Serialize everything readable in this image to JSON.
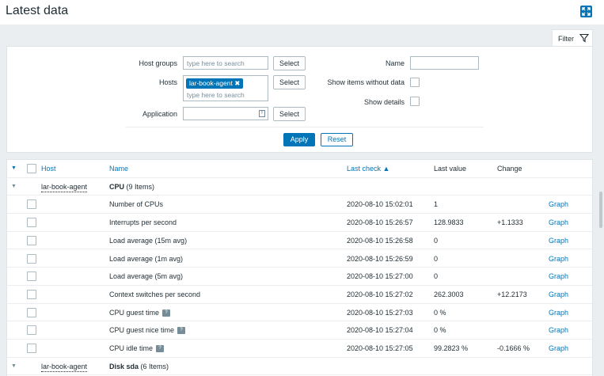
{
  "header": {
    "title": "Latest data"
  },
  "filter": {
    "tab_label": "Filter",
    "host_groups_label": "Host groups",
    "host_groups_placeholder": "type here to search",
    "select_label": "Select",
    "hosts_label": "Hosts",
    "hosts_tag": "lar-book-agent",
    "hosts_placeholder": "type here to search",
    "application_label": "Application",
    "name_label": "Name",
    "show_items_without_data_label": "Show items without data",
    "show_details_label": "Show details",
    "apply_label": "Apply",
    "reset_label": "Reset"
  },
  "table": {
    "columns": {
      "host": "Host",
      "name": "Name",
      "last_check": "Last check ▲",
      "last_value": "Last value",
      "change": "Change"
    },
    "group1": {
      "host": "lar-book-agent",
      "app": "CPU",
      "count": "(9 Items)"
    },
    "rows": [
      {
        "name": "Number of CPUs",
        "hint": false,
        "last_check": "2020-08-10 15:02:01",
        "last_value": "1",
        "change": "",
        "graph": "Graph"
      },
      {
        "name": "Interrupts per second",
        "hint": false,
        "last_check": "2020-08-10 15:26:57",
        "last_value": "128.9833",
        "change": "+1.1333",
        "graph": "Graph"
      },
      {
        "name": "Load average (15m avg)",
        "hint": false,
        "last_check": "2020-08-10 15:26:58",
        "last_value": "0",
        "change": "",
        "graph": "Graph"
      },
      {
        "name": "Load average (1m avg)",
        "hint": false,
        "last_check": "2020-08-10 15:26:59",
        "last_value": "0",
        "change": "",
        "graph": "Graph"
      },
      {
        "name": "Load average (5m avg)",
        "hint": false,
        "last_check": "2020-08-10 15:27:00",
        "last_value": "0",
        "change": "",
        "graph": "Graph"
      },
      {
        "name": "Context switches per second",
        "hint": false,
        "last_check": "2020-08-10 15:27:02",
        "last_value": "262.3003",
        "change": "+12.2173",
        "graph": "Graph"
      },
      {
        "name": "CPU guest time",
        "hint": true,
        "last_check": "2020-08-10 15:27:03",
        "last_value": "0 %",
        "change": "",
        "graph": "Graph"
      },
      {
        "name": "CPU guest nice time",
        "hint": true,
        "last_check": "2020-08-10 15:27:04",
        "last_value": "0 %",
        "change": "",
        "graph": "Graph"
      },
      {
        "name": "CPU idle time",
        "hint": true,
        "last_check": "2020-08-10 15:27:05",
        "last_value": "99.2823 %",
        "change": "-0.1666 %",
        "graph": "Graph"
      }
    ],
    "group2": {
      "host": "lar-book-agent",
      "app": "Disk sda",
      "count": "(6 Items)"
    },
    "hint_glyph": "?"
  }
}
